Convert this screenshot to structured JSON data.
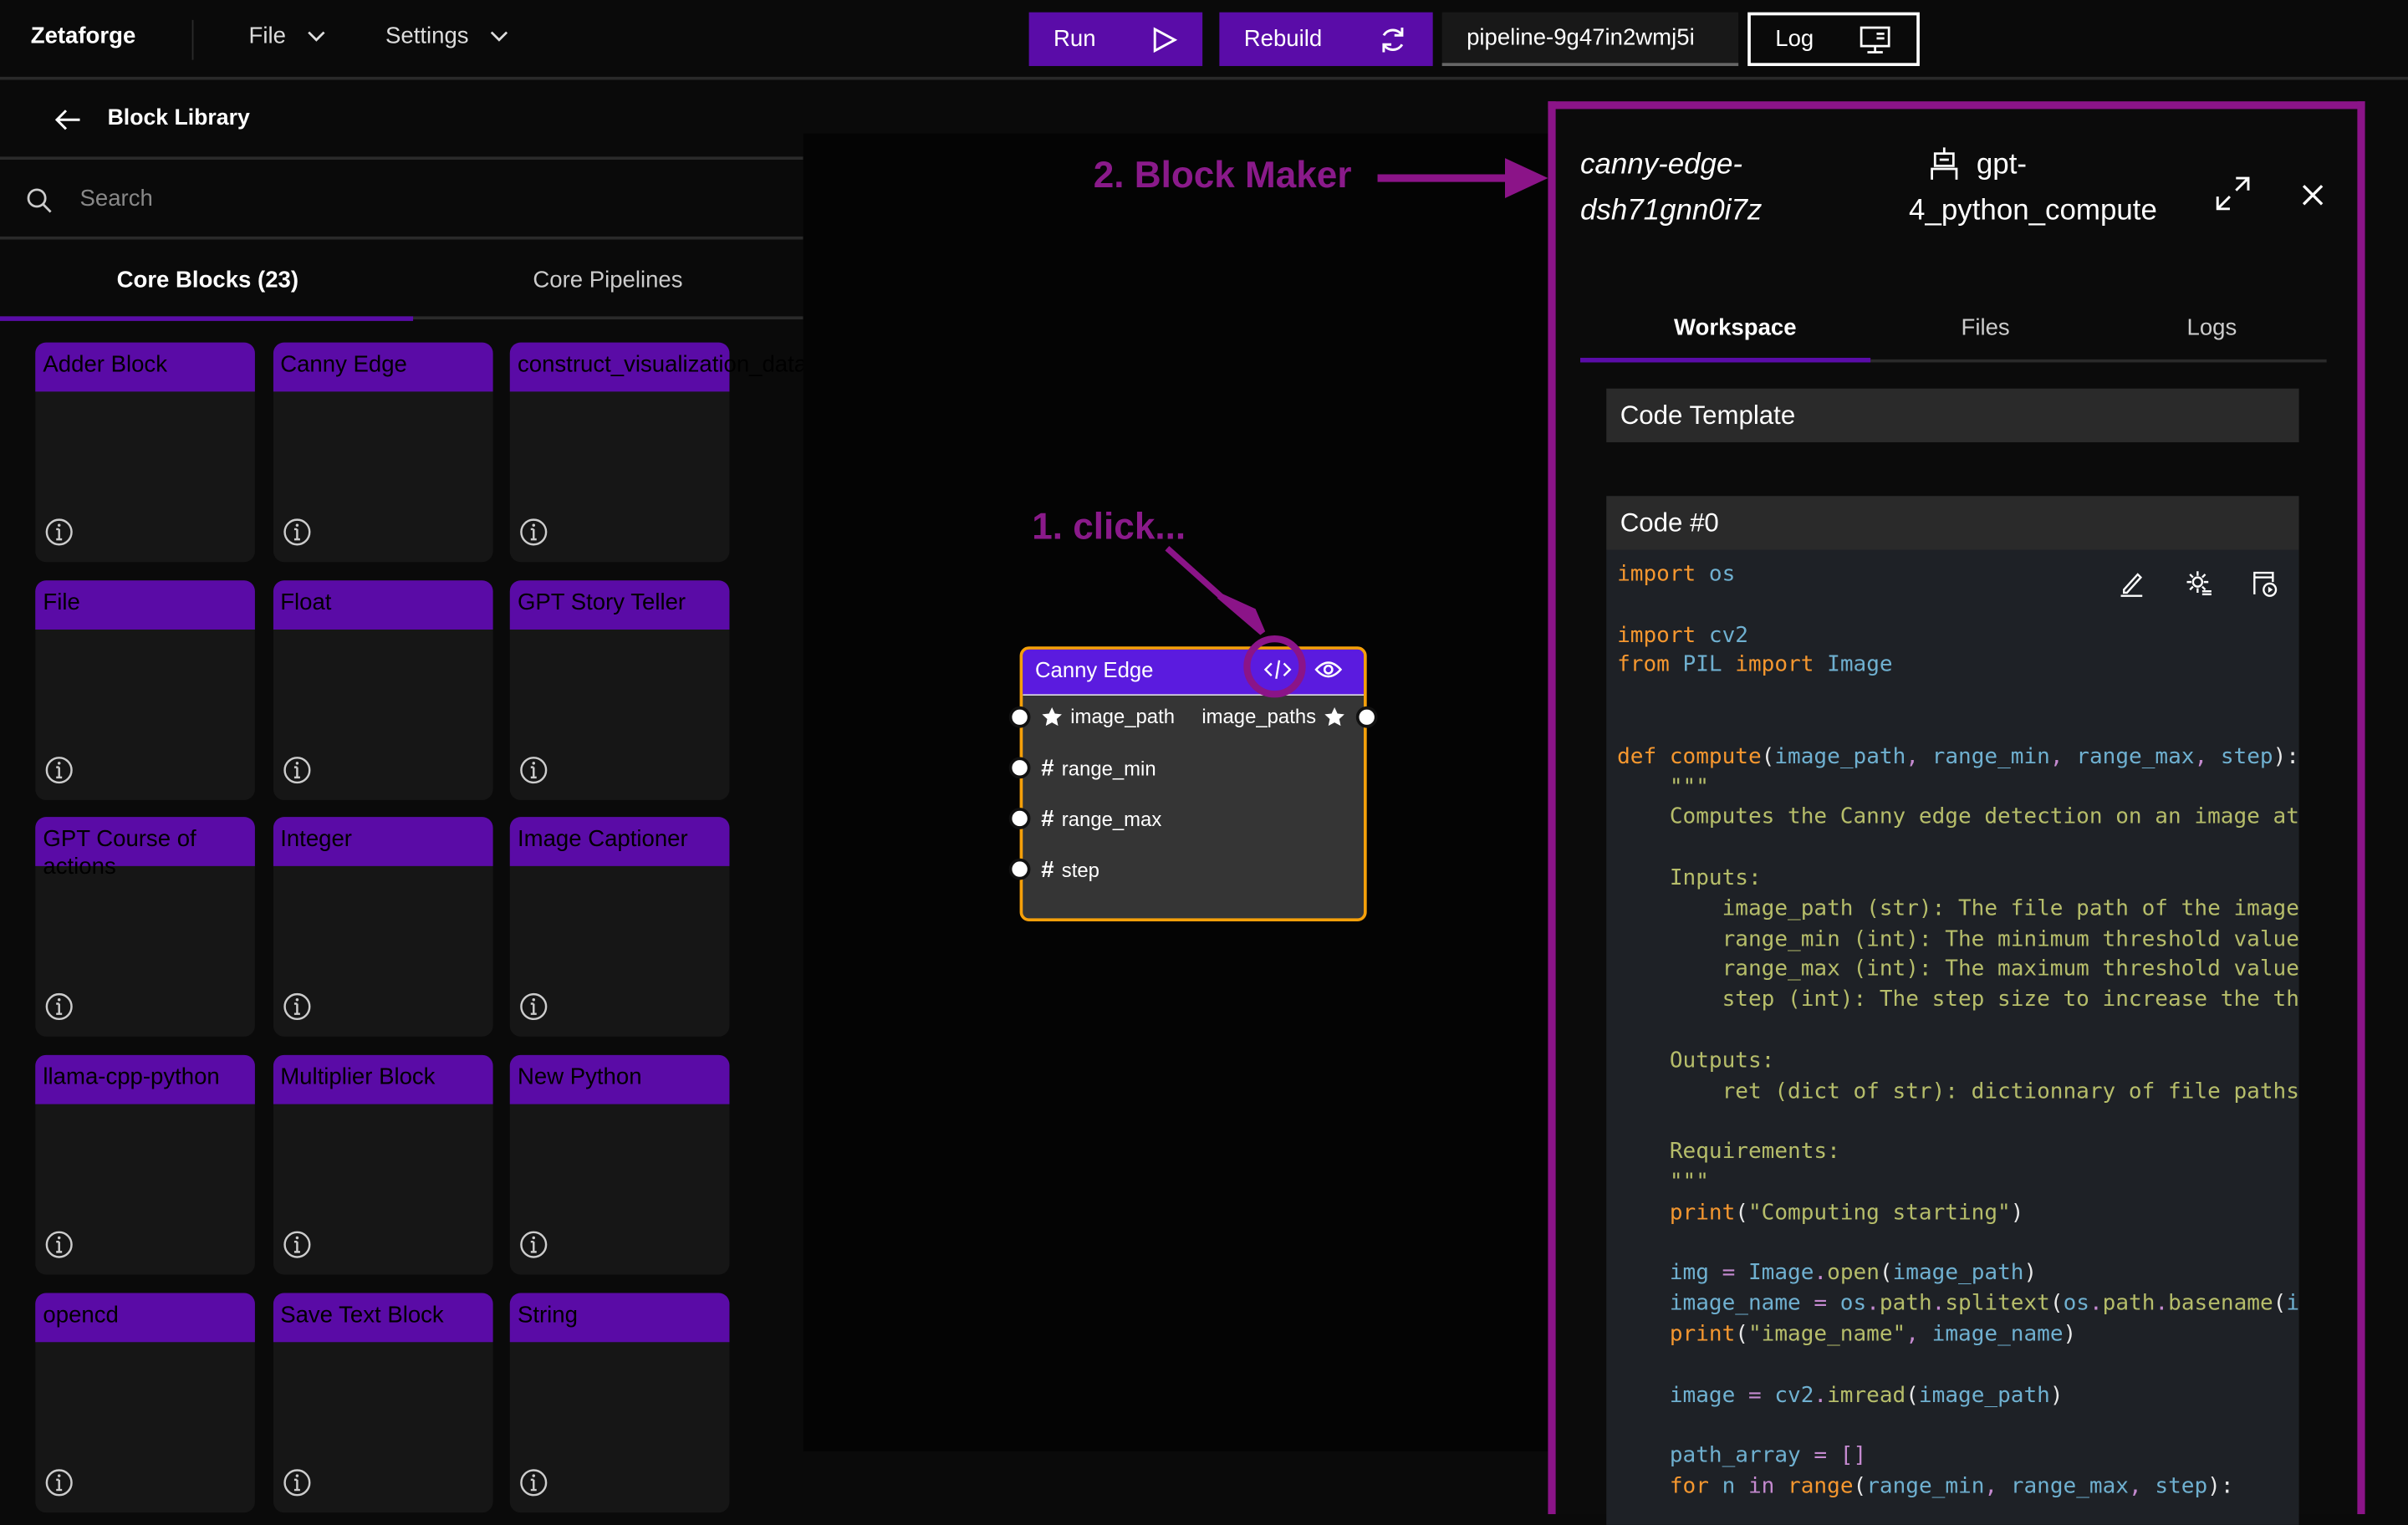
{
  "app": {
    "title": "Zetaforge",
    "menus": [
      {
        "label": "File"
      },
      {
        "label": "Settings"
      }
    ]
  },
  "toolbar": {
    "run": "Run",
    "rebuild": "Rebuild",
    "pipeline": "pipeline-9g47in2wmj5i",
    "log": "Log"
  },
  "sidebar": {
    "title": "Block Library",
    "search_placeholder": "Search",
    "tabs": [
      {
        "label": "Core Blocks (23)",
        "active": true
      },
      {
        "label": "Core Pipelines",
        "active": false
      }
    ],
    "blocks": [
      "Adder Block",
      "Canny Edge",
      "construct_visualization_data",
      "File",
      "Float",
      "GPT Story Teller",
      "GPT Course of actions",
      "Integer",
      "Image Captioner",
      "llama-cpp-python",
      "Multiplier Block",
      "New Python",
      "opencd",
      "Save Text Block",
      "String"
    ]
  },
  "node": {
    "title": "Canny Edge",
    "inputs": [
      {
        "name": "image_path",
        "type": "star"
      },
      {
        "name": "range_min",
        "type": "#"
      },
      {
        "name": "range_max",
        "type": "#"
      },
      {
        "name": "step",
        "type": "#"
      }
    ],
    "outputs": [
      {
        "name": "image_paths",
        "type": "star"
      }
    ]
  },
  "annotations": {
    "click": "1. click...",
    "block_maker": "2. Block Maker",
    "color": "#8b1488"
  },
  "panel": {
    "block_id_1": "canny-edge-",
    "block_id_2": "dsh71gnn0i7z",
    "model_1": "gpt-",
    "model_2": "4_python_compute",
    "tabs": [
      {
        "label": "Workspace",
        "active": true
      },
      {
        "label": "Files"
      },
      {
        "label": "Logs"
      }
    ],
    "code_template": "Code Template",
    "code_title": "Code #0"
  },
  "colors": {
    "accent": "#5a0ca8",
    "node_border": "#f5a00a",
    "kw": "#f5972f",
    "id": "#6fb0d0",
    "str": "#b6bd6a",
    "op": "#c58ad0",
    "p": "#e8e8e8"
  },
  "code_lines": [
    [
      [
        "import",
        "kw"
      ],
      [
        " os",
        "id"
      ]
    ],
    [],
    [
      [
        "import",
        "kw"
      ],
      [
        " cv2",
        "id"
      ]
    ],
    [
      [
        "from",
        "kw"
      ],
      [
        " PIL ",
        "id"
      ],
      [
        "import",
        "kw"
      ],
      [
        " Image",
        "id"
      ]
    ],
    [],
    [],
    [
      [
        "def ",
        "kw"
      ],
      [
        "compute",
        "kw"
      ],
      [
        "(",
        "p"
      ],
      [
        "image_path",
        "id"
      ],
      [
        ", ",
        "op"
      ],
      [
        "range_min",
        "id"
      ],
      [
        ", ",
        "op"
      ],
      [
        "range_max",
        "id"
      ],
      [
        ", ",
        "op"
      ],
      [
        "step",
        "id"
      ],
      [
        "):",
        "p"
      ]
    ],
    [
      [
        "    \"\"\"",
        "str"
      ]
    ],
    [
      [
        "    Computes the Canny edge detection on an image at",
        "str"
      ]
    ],
    [],
    [
      [
        "    Inputs:",
        "str"
      ]
    ],
    [
      [
        "        image_path (str): The file path of the image",
        "str"
      ]
    ],
    [
      [
        "        range_min (int): The minimum threshold value",
        "str"
      ]
    ],
    [
      [
        "        range_max (int): The maximum threshold value",
        "str"
      ]
    ],
    [
      [
        "        step (int): The step size to increase the th",
        "str"
      ]
    ],
    [],
    [
      [
        "    Outputs:",
        "str"
      ]
    ],
    [
      [
        "        ret (dict of str): dictionnary of file paths",
        "str"
      ]
    ],
    [],
    [
      [
        "    Requirements:",
        "str"
      ]
    ],
    [
      [
        "    \"\"\"",
        "str"
      ]
    ],
    [
      [
        "    print",
        "kw"
      ],
      [
        "(",
        "p"
      ],
      [
        "\"Computing starting\"",
        "str"
      ],
      [
        ")",
        "p"
      ]
    ],
    [],
    [
      [
        "    img",
        "id"
      ],
      [
        " = ",
        "op"
      ],
      [
        "Image",
        "id"
      ],
      [
        ".",
        "op"
      ],
      [
        "open",
        "str"
      ],
      [
        "(",
        "p"
      ],
      [
        "image_path",
        "id"
      ],
      [
        ")",
        "p"
      ]
    ],
    [
      [
        "    image_name",
        "id"
      ],
      [
        " = ",
        "op"
      ],
      [
        "os",
        "id"
      ],
      [
        ".",
        "op"
      ],
      [
        "path",
        "str"
      ],
      [
        ".",
        "op"
      ],
      [
        "splitext",
        "str"
      ],
      [
        "(",
        "p"
      ],
      [
        "os",
        "id"
      ],
      [
        ".",
        "op"
      ],
      [
        "path",
        "str"
      ],
      [
        ".",
        "op"
      ],
      [
        "basename",
        "str"
      ],
      [
        "(",
        "p"
      ],
      [
        "i",
        "id"
      ]
    ],
    [
      [
        "    print",
        "kw"
      ],
      [
        "(",
        "p"
      ],
      [
        "\"image_name\"",
        "str"
      ],
      [
        ", ",
        "op"
      ],
      [
        "image_name",
        "id"
      ],
      [
        ")",
        "p"
      ]
    ],
    [],
    [
      [
        "    image",
        "id"
      ],
      [
        " = ",
        "op"
      ],
      [
        "cv2",
        "id"
      ],
      [
        ".",
        "op"
      ],
      [
        "imread",
        "str"
      ],
      [
        "(",
        "p"
      ],
      [
        "image_path",
        "id"
      ],
      [
        ")",
        "p"
      ]
    ],
    [],
    [
      [
        "    path_array",
        "id"
      ],
      [
        " = ",
        "op"
      ],
      [
        "[]",
        "op"
      ]
    ],
    [
      [
        "    for",
        "kw"
      ],
      [
        " n ",
        "id"
      ],
      [
        "in",
        "op"
      ],
      [
        " range",
        "kw"
      ],
      [
        "(",
        "p"
      ],
      [
        "range_min",
        "id"
      ],
      [
        ", ",
        "op"
      ],
      [
        "range_max",
        "id"
      ],
      [
        ", ",
        "op"
      ],
      [
        "step",
        "id"
      ],
      [
        "):",
        "p"
      ]
    ]
  ]
}
